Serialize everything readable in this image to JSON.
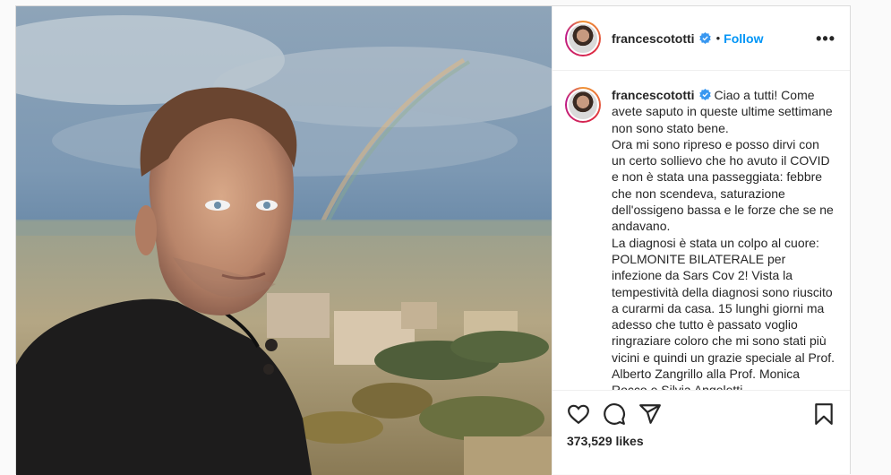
{
  "post": {
    "username": "francescototti",
    "follow_label": "Follow",
    "dot": "•",
    "more_label": "•••",
    "caption": "Ciao a tutti! Come avete saputo in queste ultime settimane non sono stato bene.\nOra mi sono ripreso e posso dirvi con un certo sollievo che ho avuto il COVID e non è stata una passeggiata: febbre che non scendeva, saturazione dell'ossigeno bassa e le forze che se ne andavano.\nLa diagnosi è stata un colpo al cuore: POLMONITE BILATERALE per infezione da Sars Cov 2! Vista la tempestività della diagnosi sono riuscito a curarmi da casa. 15 lunghi giorni ma adesso che tutto è passato voglio ringraziare coloro che mi sono stati più vicini e quindi un grazie speciale al Prof. Alberto Zangrillo alla Prof. Monica Rocco e Silvia Angeletti.\nIl COVID si può battere anche giocando",
    "likes": "373,529 likes"
  },
  "icons": {
    "heart": "heart-icon",
    "comment": "comment-icon",
    "share": "share-icon",
    "save": "bookmark-icon",
    "verified": "verified-badge-icon"
  },
  "colors": {
    "accent": "#0095f6",
    "text": "#262626",
    "border": "#dbdbdb"
  }
}
